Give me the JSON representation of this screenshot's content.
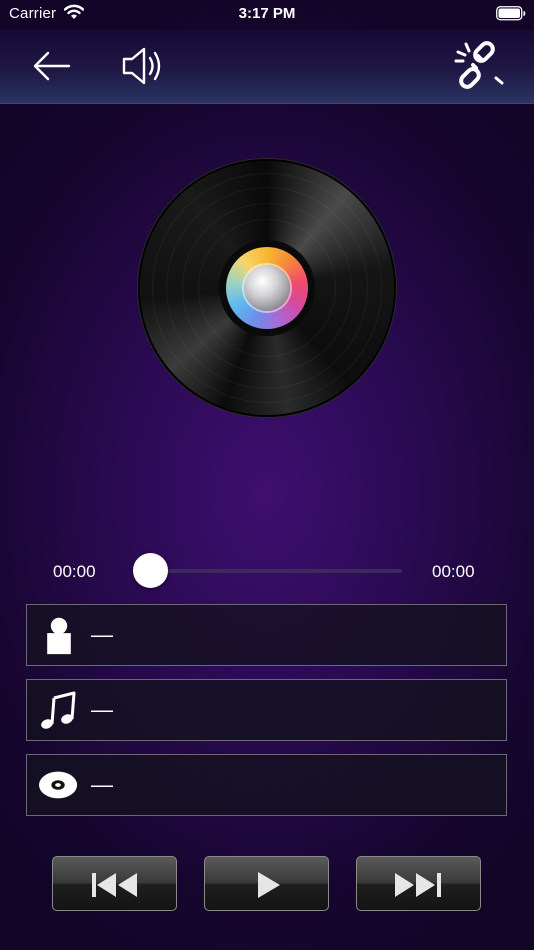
{
  "status_bar": {
    "carrier": "Carrier",
    "time": "3:17 PM"
  },
  "navbar": {
    "icons": [
      "back-arrow-icon",
      "speaker-volume-icon",
      "broken-link-icon"
    ]
  },
  "player": {
    "artwork": "vinyl-record",
    "time_elapsed": "00:00",
    "time_total": "00:00",
    "progress": 0.0
  },
  "info": {
    "artist": {
      "icon": "person-icon",
      "value": "—"
    },
    "song": {
      "icon": "music-note-icon",
      "value": "—"
    },
    "album": {
      "icon": "disc-icon",
      "value": "—"
    }
  },
  "controls": {
    "icons": [
      "previous-icon",
      "play-icon",
      "next-icon"
    ]
  },
  "colors": {
    "accent": "#2a0a52",
    "row_border": "#6b6878"
  }
}
